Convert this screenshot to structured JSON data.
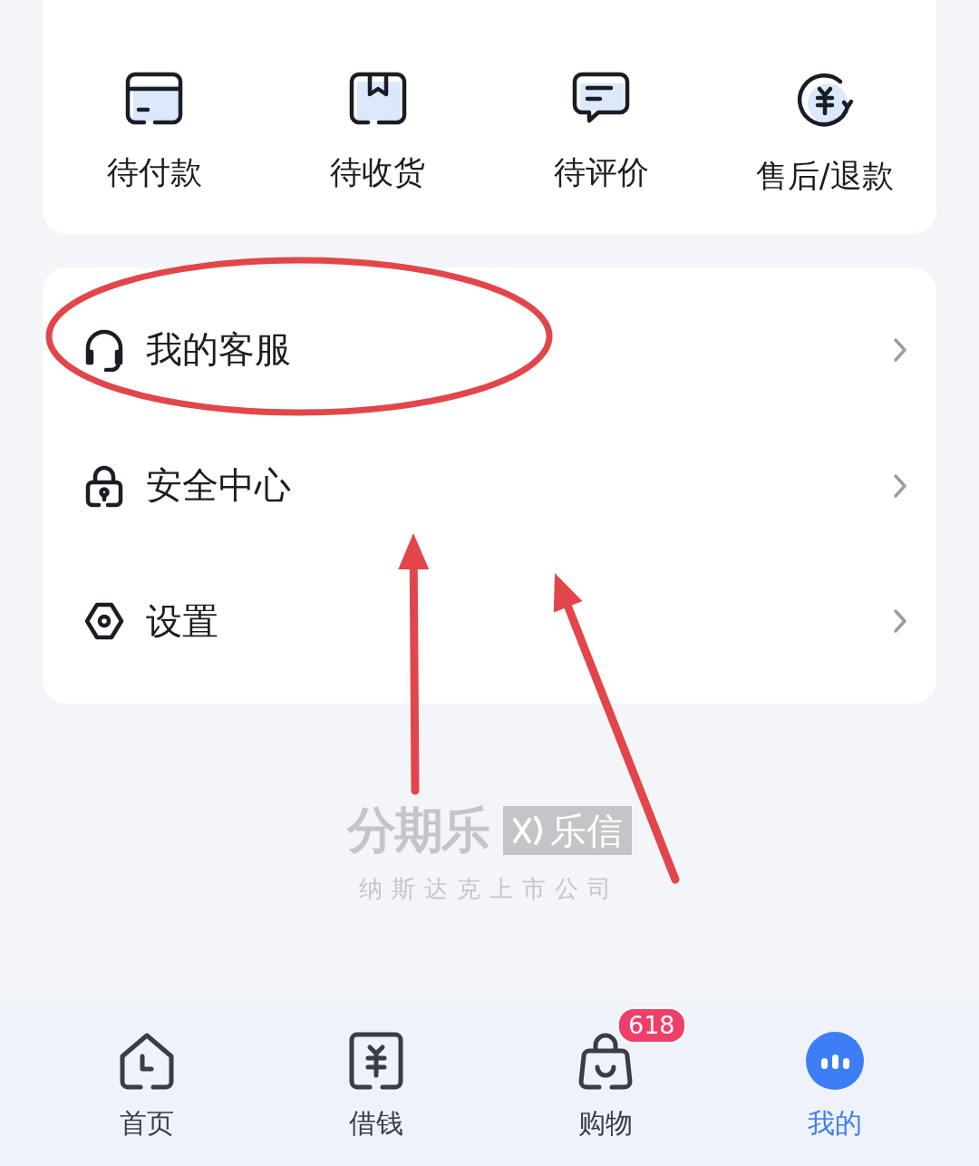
{
  "orders": [
    {
      "kind": "card",
      "label": "待付款"
    },
    {
      "kind": "box",
      "label": "待收货"
    },
    {
      "kind": "chat",
      "label": "待评价"
    },
    {
      "kind": "refund",
      "label": "售后/退款"
    }
  ],
  "menu": [
    {
      "kind": "headset",
      "label": "我的客服"
    },
    {
      "kind": "lock",
      "label": "安全中心"
    },
    {
      "kind": "settings",
      "label": "设置"
    }
  ],
  "brand": {
    "name": "分期乐",
    "partner": "乐信",
    "tagline": "纳斯达克上市公司"
  },
  "annotations": [
    {
      "kind": "ellipse"
    },
    {
      "kind": "arrow"
    },
    {
      "kind": "arrow"
    }
  ],
  "tab_bar": [
    {
      "kind": "home",
      "label": "首页",
      "selected": false
    },
    {
      "kind": "loan",
      "label": "借钱",
      "selected": false
    },
    {
      "kind": "shop",
      "label": "购物",
      "selected": false,
      "badge": "618"
    },
    {
      "kind": "me",
      "label": "我的",
      "selected": true
    }
  ]
}
